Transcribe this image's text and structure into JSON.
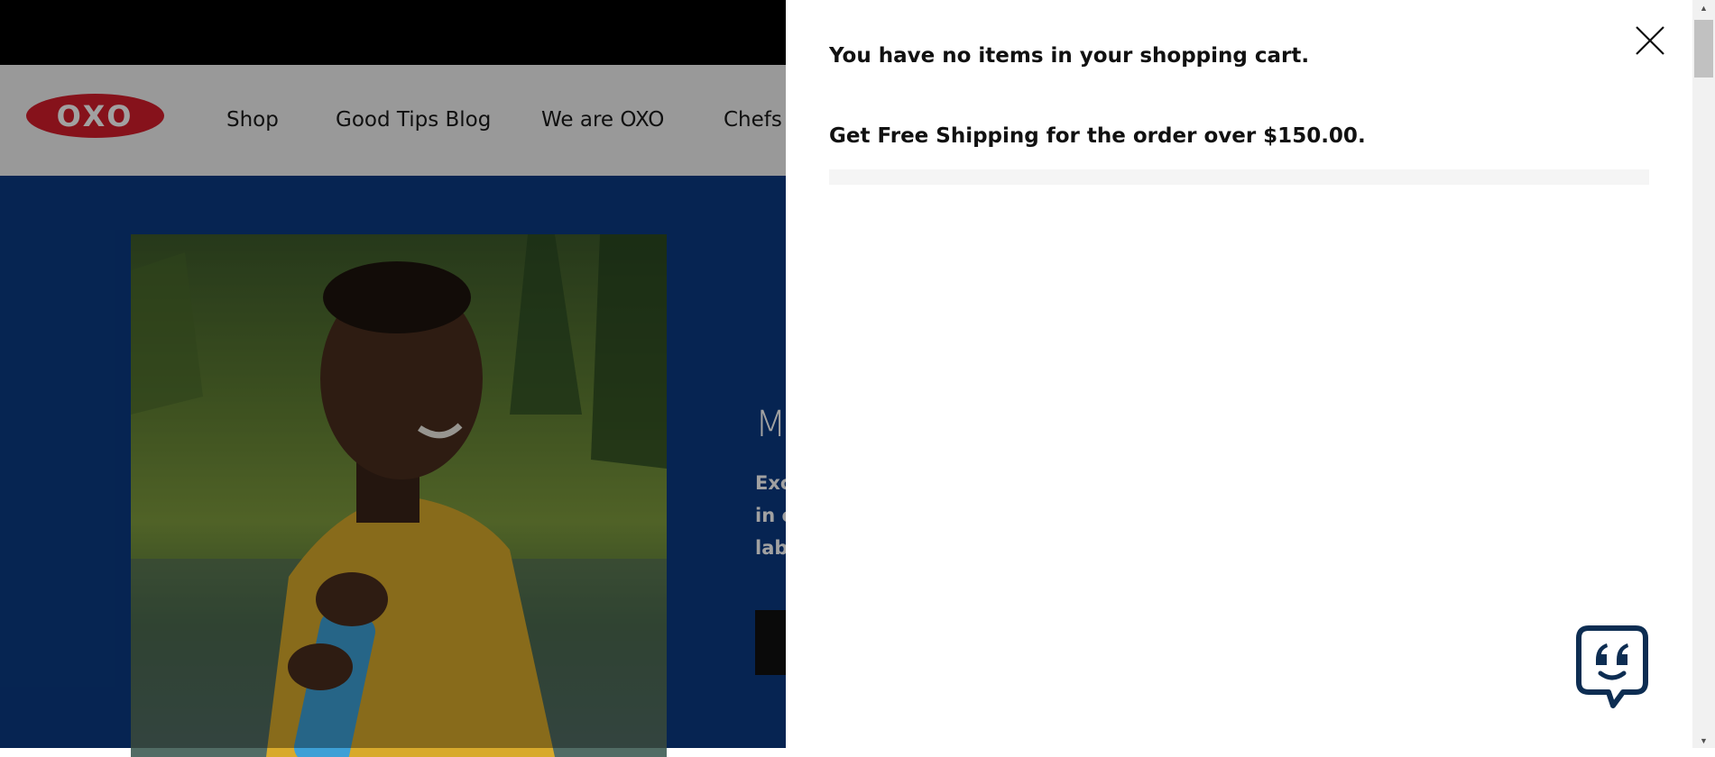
{
  "site": {
    "logo_text": "OXO",
    "nav": [
      {
        "label": "Shop"
      },
      {
        "label": "Good Tips Blog"
      },
      {
        "label": "We are OXO"
      },
      {
        "label": "Chefs i"
      }
    ]
  },
  "hero": {
    "title_fragment": "M",
    "text_lines": [
      "Exc",
      "in c",
      "lab"
    ],
    "colors": {
      "background": "#0a3a82",
      "button": "#111111"
    }
  },
  "minicart": {
    "empty_message": "You have no items in your shopping cart.",
    "shipping_message": "Get Free Shipping for the order over $150.00.",
    "shipping_progress": 0,
    "close_icon": "close-icon"
  },
  "chat_widget": {
    "icon": "chat-quote-icon",
    "color": "#0d2d52"
  },
  "scrollbar": {
    "up_icon": "▲",
    "down_icon": "▼"
  },
  "colors": {
    "brand_red": "#d41e2b",
    "top_bar": "#000000",
    "header": "#f2f2f2"
  }
}
